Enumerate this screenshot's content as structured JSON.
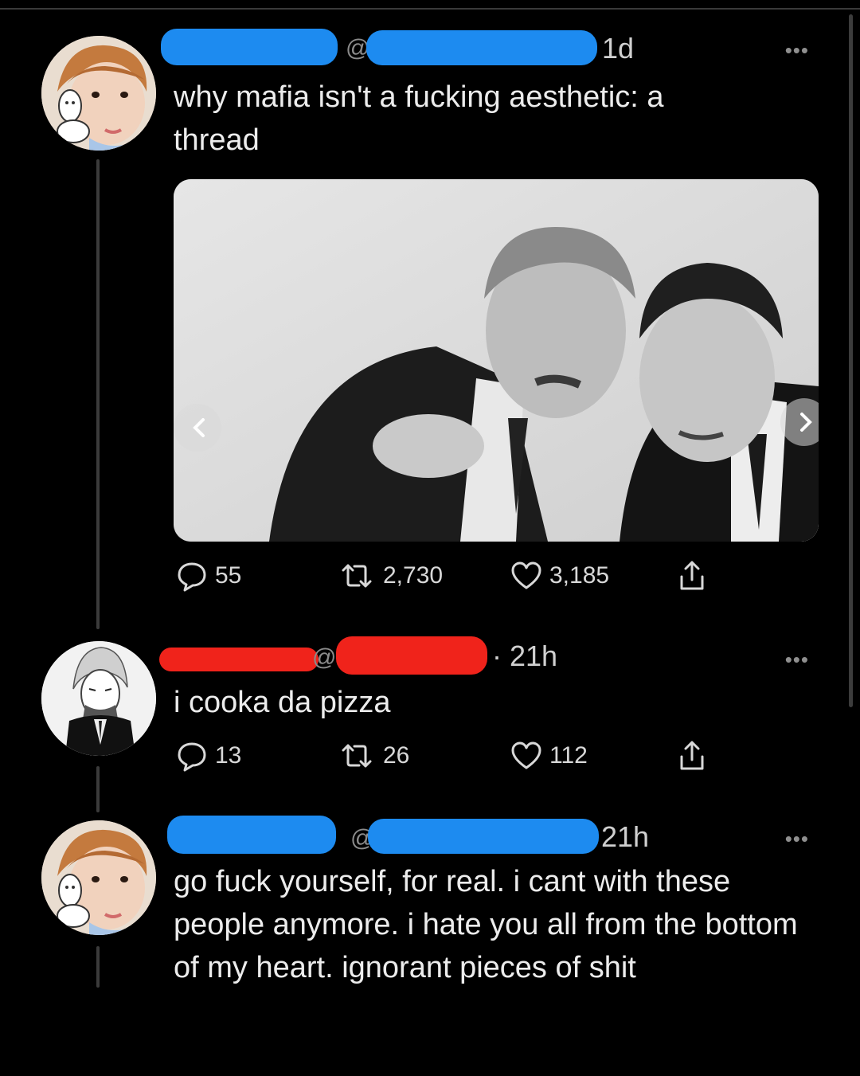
{
  "tweets": [
    {
      "time": "1d",
      "at": "@",
      "text": "why mafia isn't a fucking aesthetic: a thread",
      "stats": {
        "replies": "55",
        "retweets": "2,730",
        "likes": "3,185"
      }
    },
    {
      "time": "· 21h",
      "at": "@",
      "text": "i cooka da pizza",
      "stats": {
        "replies": "13",
        "retweets": "26",
        "likes": "112"
      }
    },
    {
      "time": "21h",
      "at": "@",
      "text": "go fuck yourself, for real. i cant with these people anymore. i hate you all from the bottom of my heart. ignorant pieces of shit"
    }
  ],
  "more_label": "•••",
  "colors": {
    "redact_blue": "#1d8bf0",
    "redact_red": "#f0231b",
    "background": "#000000",
    "text": "#ececec"
  },
  "icons": [
    "reply-icon",
    "retweet-icon",
    "like-icon",
    "share-icon",
    "chevron-left-icon",
    "chevron-right-icon"
  ]
}
